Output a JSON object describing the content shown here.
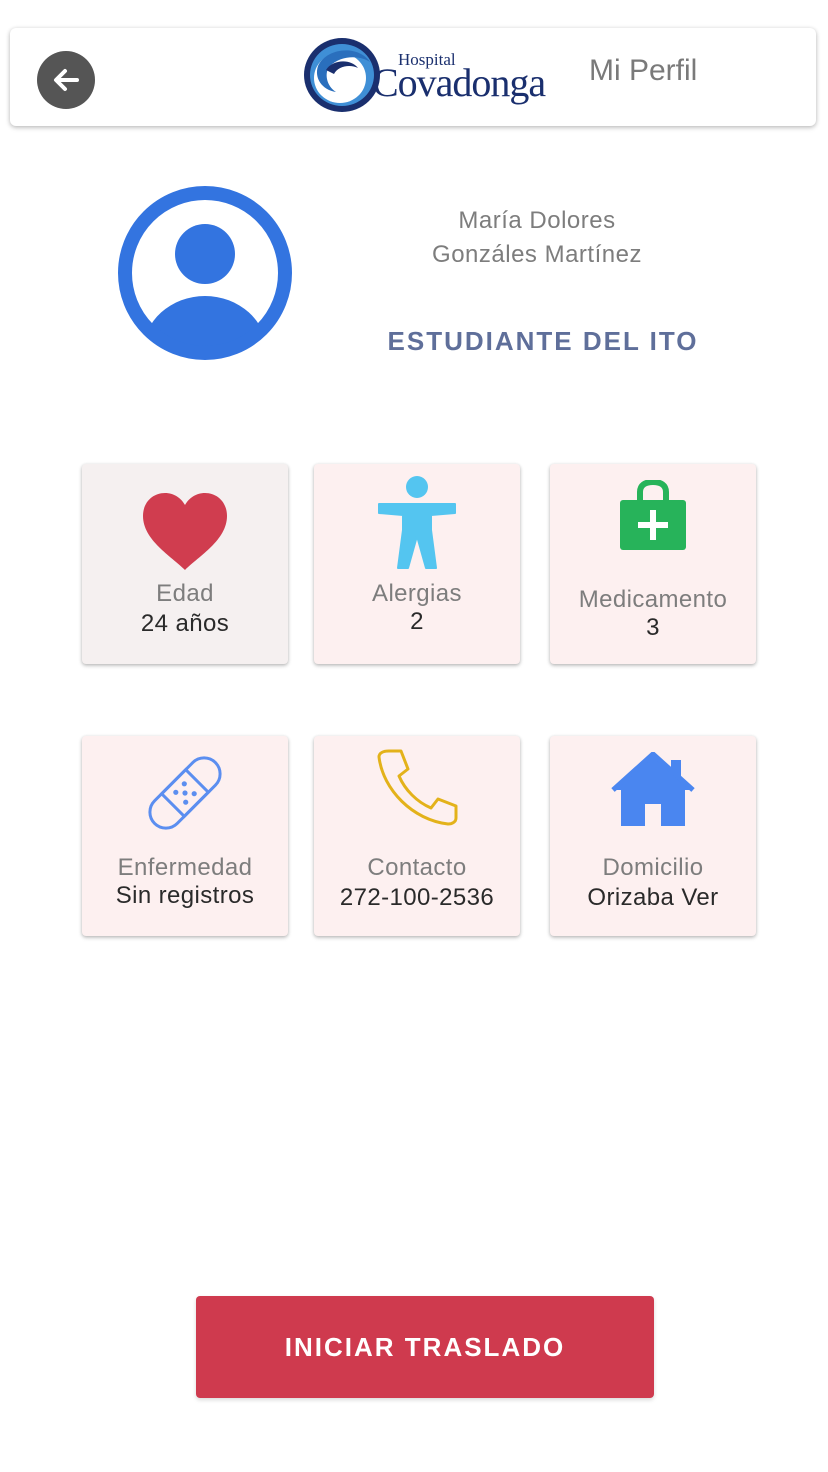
{
  "header": {
    "logo_small": "Hospital",
    "logo_big": "Covadonga",
    "title": "Mi Perfil",
    "back_icon": "arrow-left-icon"
  },
  "profile": {
    "name_line1": "María Dolores",
    "name_line2": "Gonzáles Martínez",
    "role": "ESTUDIANTE DEL ITO",
    "avatar_icon": "user-circle-icon",
    "avatar_color": "#3374e0"
  },
  "cards": [
    {
      "icon": "heart-icon",
      "label": "Edad",
      "value": "24 años",
      "color": "#d03d4f"
    },
    {
      "icon": "person-icon",
      "label": "Alergias",
      "value": "2",
      "color": "#54c5f0"
    },
    {
      "icon": "medical-bag-icon",
      "label": "Medicamento",
      "value": "3",
      "color": "#27b35a"
    },
    {
      "icon": "bandage-icon",
      "label": "Enfermedad",
      "value": "Sin registros",
      "color": "#5b8ef0"
    },
    {
      "icon": "phone-icon",
      "label": "Contacto",
      "value": "272-100-2536",
      "color": "#e3b21a"
    },
    {
      "icon": "house-icon",
      "label": "Domicilio",
      "value": "Orizaba Ver",
      "color": "#4a86f0"
    }
  ],
  "action": {
    "label": "INICIAR TRASLADO",
    "color": "#cf3a4e"
  }
}
